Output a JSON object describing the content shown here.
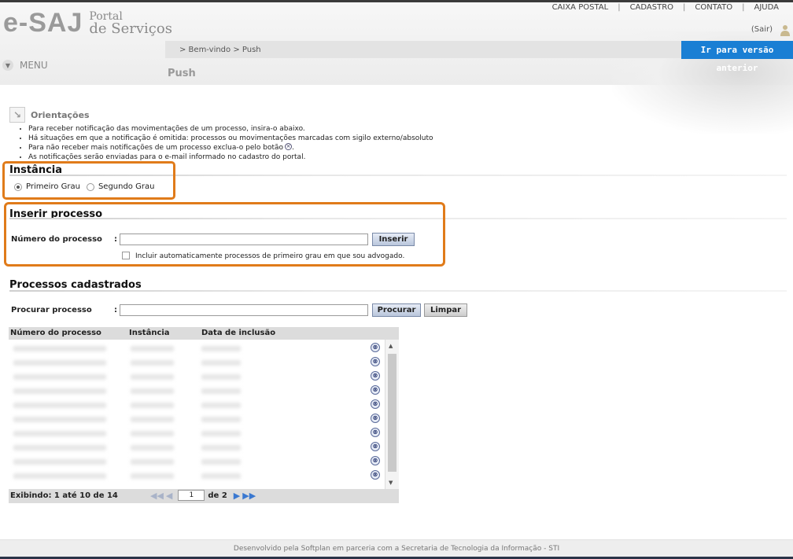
{
  "header": {
    "logo_main": "e-SAJ",
    "logo_sub_line1": "Portal",
    "logo_sub_line2": "de Serviços",
    "top_links": [
      "CAIXA POSTAL",
      "CADASTRO",
      "CONTATO",
      "AJUDA"
    ],
    "logout_label": "(Sair)",
    "breadcrumb": "> Bem-vindo > Push",
    "old_version_button": "Ir para versão anterior",
    "menu_label": "MENU",
    "page_title": "Push"
  },
  "orientations": {
    "title": "Orientações",
    "items": [
      "Para receber notificação das movimentações de um processo, insira-o abaixo.",
      "Há situações em que a notificação é omitida: processos ou movimentações marcadas com sigilo externo/absoluto",
      "Para não receber mais notificações de um processo exclua-o pelo botão",
      "As notificações serão enviadas para o e-mail informado no cadastro do portal."
    ]
  },
  "instance": {
    "title": "Instância",
    "options": [
      "Primeiro Grau",
      "Segundo Grau"
    ],
    "selected": "Primeiro Grau"
  },
  "insert": {
    "title": "Inserir processo",
    "process_label": "Número do processo",
    "colon": ":",
    "process_value": "",
    "insert_button": "Inserir",
    "auto_include_label": "Incluir automaticamente processos de primeiro grau em que sou advogado.",
    "auto_include_checked": false
  },
  "registered": {
    "title": "Processos cadastrados",
    "search_label": "Procurar processo",
    "colon": ":",
    "search_value": "",
    "search_button": "Procurar",
    "clear_button": "Limpar",
    "columns": [
      "Número do processo",
      "Instância",
      "Data de inclusão"
    ],
    "row_count_visible": 10,
    "delete_symbol": "⊗",
    "status": "Exibindo: 1 até 10 de 14",
    "page_current": "1",
    "page_total_label": "de 2",
    "first_icon": "double-left-arrow-icon",
    "prev_icon": "left-arrow-icon",
    "next_icon": "right-arrow-icon",
    "last_icon": "double-right-arrow-icon"
  },
  "footer": {
    "text": "Desenvolvido pela Softplan em parceria com a Secretaria de Tecnologia da Informação - STI"
  },
  "colors": {
    "accent_blue": "#1a7fd4",
    "highlight_orange": "#e07b1a"
  }
}
